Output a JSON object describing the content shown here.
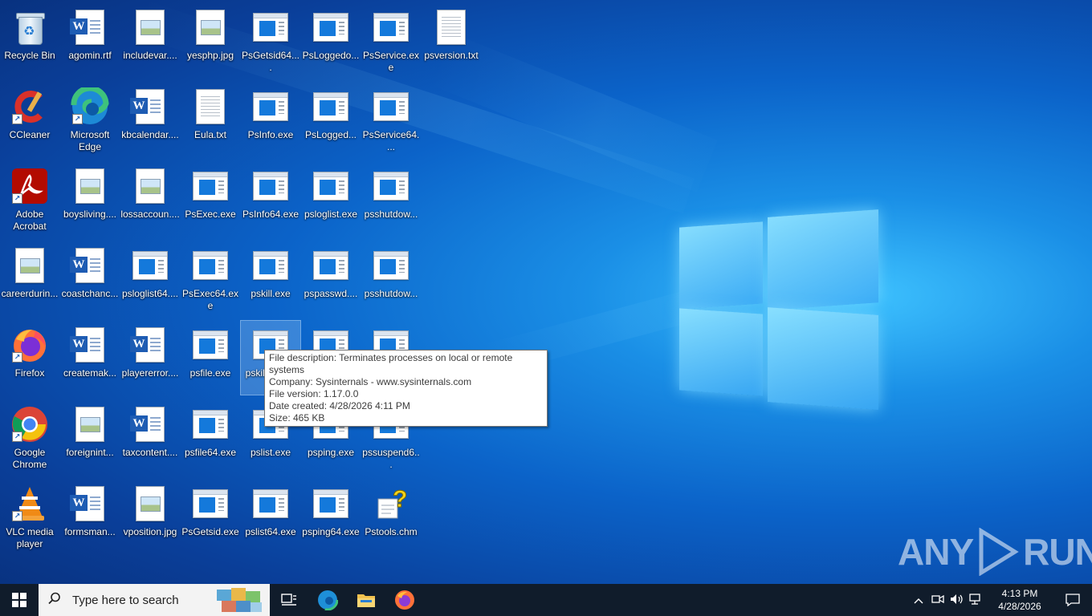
{
  "desktop": {
    "icons": [
      {
        "label": "Recycle Bin",
        "icon": "recycle-bin-icon"
      },
      {
        "label": "CCleaner",
        "icon": "ccleaner-icon"
      },
      {
        "label": "Adobe Acrobat",
        "icon": "acrobat-icon"
      },
      {
        "label": "careerdurin...",
        "icon": "image-file-icon"
      },
      {
        "label": "Firefox",
        "icon": "firefox-icon"
      },
      {
        "label": "Google Chrome",
        "icon": "chrome-icon"
      },
      {
        "label": "VLC media player",
        "icon": "vlc-icon"
      },
      {
        "label": "agomin.rtf",
        "icon": "word-doc-icon"
      },
      {
        "label": "Microsoft Edge",
        "icon": "edge-icon"
      },
      {
        "label": "boysliving....",
        "icon": "image-file-icon"
      },
      {
        "label": "coastchanc...",
        "icon": "word-doc-icon"
      },
      {
        "label": "createmak...",
        "icon": "word-doc-icon"
      },
      {
        "label": "foreignint...",
        "icon": "image-file-icon"
      },
      {
        "label": "formsman...",
        "icon": "word-doc-icon"
      },
      {
        "label": "includevar....",
        "icon": "image-file-icon"
      },
      {
        "label": "kbcalendar....",
        "icon": "word-doc-icon"
      },
      {
        "label": "lossaccoun....",
        "icon": "image-file-icon"
      },
      {
        "label": "psloglist64....",
        "icon": "exe-icon"
      },
      {
        "label": "playererror....",
        "icon": "word-doc-icon"
      },
      {
        "label": "taxcontent....",
        "icon": "word-doc-icon"
      },
      {
        "label": "vposition.jpg",
        "icon": "image-file-icon"
      },
      {
        "label": "yesphp.jpg",
        "icon": "image-file-icon"
      },
      {
        "label": "Eula.txt",
        "icon": "text-file-icon"
      },
      {
        "label": "PsExec.exe",
        "icon": "exe-icon"
      },
      {
        "label": "PsExec64.exe",
        "icon": "exe-icon"
      },
      {
        "label": "psfile.exe",
        "icon": "exe-icon"
      },
      {
        "label": "psfile64.exe",
        "icon": "exe-icon"
      },
      {
        "label": "PsGetsid.exe",
        "icon": "exe-icon"
      },
      {
        "label": "PsGetsid64....",
        "icon": "exe-icon"
      },
      {
        "label": "PsInfo.exe",
        "icon": "exe-icon"
      },
      {
        "label": "PsInfo64.exe",
        "icon": "exe-icon"
      },
      {
        "label": "pskill.exe",
        "icon": "exe-icon"
      },
      {
        "label": "pskill64.exe",
        "icon": "exe-icon"
      },
      {
        "label": "pslist.exe",
        "icon": "exe-icon"
      },
      {
        "label": "pslist64.exe",
        "icon": "exe-icon"
      },
      {
        "label": "PsLoggedo...",
        "icon": "exe-icon"
      },
      {
        "label": "PsLogged...",
        "icon": "exe-icon"
      },
      {
        "label": "psloglist.exe",
        "icon": "exe-icon"
      },
      {
        "label": "pspasswd....",
        "icon": "exe-icon"
      },
      {
        "label": "",
        "icon": "exe-icon"
      },
      {
        "label": "psping.exe",
        "icon": "exe-icon"
      },
      {
        "label": "psping64.exe",
        "icon": "exe-icon"
      },
      {
        "label": "PsService.exe",
        "icon": "exe-icon"
      },
      {
        "label": "PsService64....",
        "icon": "exe-icon"
      },
      {
        "label": "psshutdow...",
        "icon": "exe-icon"
      },
      {
        "label": "psshutdow...",
        "icon": "exe-icon"
      },
      {
        "label": "",
        "icon": "exe-icon"
      },
      {
        "label": "pssuspend6...",
        "icon": "exe-icon"
      },
      {
        "label": "Pstools.chm",
        "icon": "help-file-icon"
      },
      {
        "label": "psversion.txt",
        "icon": "text-file-icon"
      }
    ]
  },
  "tooltip": {
    "line1": "File description: Terminates processes on local or remote systems",
    "line2": "Company: Sysinternals - www.sysinternals.com",
    "line3": "File version: 1.17.0.0",
    "line4": "Date created: 4/28/2026 4:11 PM",
    "line5": "Size: 465 KB"
  },
  "watermark": {
    "text_left": "ANY",
    "text_right": "RUN"
  },
  "taskbar": {
    "search_placeholder": "Type here to search",
    "apps": [
      "task-view-icon",
      "edge-icon",
      "file-explorer-icon",
      "firefox-icon"
    ],
    "clock_time": "4:13 PM",
    "clock_date": "4/28/2026"
  },
  "colors": {
    "taskbar": "#101c2b",
    "accent": "#1479db",
    "desktop_bg": "#0b63c9"
  }
}
